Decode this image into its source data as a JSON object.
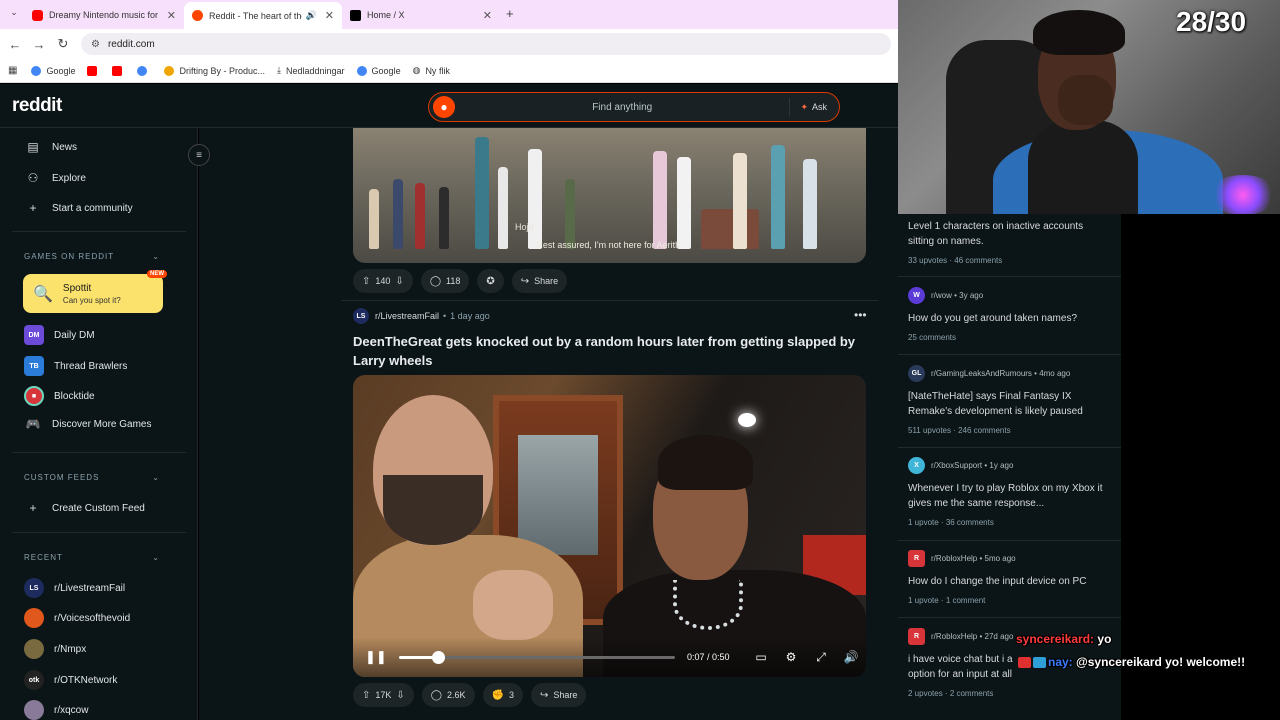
{
  "browser": {
    "tabs": [
      {
        "title": "Dreamy Nintendo music for sle",
        "color": "#ff0000"
      },
      {
        "title": "Reddit - The heart of the in",
        "color": "#ff4500"
      },
      {
        "title": "Home / X",
        "color": "#000000"
      }
    ],
    "url": "reddit.com",
    "bookmarks": [
      {
        "label": "Google",
        "color": "#4285f4"
      },
      {
        "label": "",
        "color": "#ff0000"
      },
      {
        "label": "",
        "color": "#ff0000"
      },
      {
        "label": "",
        "color": "#4285f4"
      },
      {
        "label": "Drifting By - Produc...",
        "color": "#f0a500"
      },
      {
        "label": "Nedladdningar",
        "color": "#333333"
      },
      {
        "label": "Google",
        "color": "#4285f4"
      },
      {
        "label": "Ny flik",
        "color": "#555555"
      }
    ]
  },
  "reddit": {
    "logo": "reddit",
    "search_placeholder": "Find anything",
    "ask_label": "Ask"
  },
  "sidebar": {
    "nav": [
      {
        "label": "News",
        "icon": "news-icon"
      },
      {
        "label": "Explore",
        "icon": "explore-icon"
      },
      {
        "label": "Start a community",
        "icon": "plus-icon"
      }
    ],
    "games_heading": "GAMES ON REDDIT",
    "spottit": {
      "title": "Spottit",
      "subtitle": "Can you spot it?",
      "badge": "NEW"
    },
    "games": [
      {
        "label": "Daily DM",
        "color": "#6b4bd8"
      },
      {
        "label": "Thread Brawlers",
        "color": "#2b7bd8"
      },
      {
        "label": "Blocktide",
        "color": "#d8353b"
      },
      {
        "label": "Discover More Games",
        "color": "#0b1416"
      }
    ],
    "custom_heading": "CUSTOM FEEDS",
    "create_feed": "Create Custom Feed",
    "recent_heading": "RECENT",
    "recent": [
      {
        "label": "r/LivestreamFail",
        "color": "#1d2b5e"
      },
      {
        "label": "r/Voicesofthevoid",
        "color": "#e0581c"
      },
      {
        "label": "r/Nmpx",
        "color": "#7a6a40"
      },
      {
        "label": "r/OTKNetwork",
        "color": "#222222"
      },
      {
        "label": "r/xqcow",
        "color": "#8a7a9a"
      }
    ]
  },
  "feed": {
    "post1": {
      "caption_name": "Hojo",
      "caption_text": "Rest assured, I'm not here for Aerith.",
      "upvotes": "140",
      "comments": "118",
      "share": "Share"
    },
    "post2": {
      "subreddit": "r/LivestreamFail",
      "avatar": "LS",
      "time": "1 day ago",
      "title": "DeenTheGreat gets knocked out by a random hours later from getting slapped by Larry wheels",
      "video_time": "0:07 / 0:50",
      "progress": 0.14,
      "upvotes": "17K",
      "comments": "2.6K",
      "awards": "3",
      "share": "Share"
    }
  },
  "rail": {
    "posts": [
      {
        "subreddit": "",
        "time": "",
        "title": "Level 1 characters on inactive accounts sitting on names.",
        "upvotes": "33 upvotes",
        "comments": "46 comments",
        "color": ""
      },
      {
        "subreddit": "r/wow",
        "time": "3y ago",
        "title": "How do you get around taken names?",
        "upvotes": "",
        "comments": "25 comments",
        "color": "#5a3bd6"
      },
      {
        "subreddit": "r/GamingLeaksAndRumours",
        "time": "4mo ago",
        "title": "[NateTheHate] says Final Fantasy IX Remake's development is likely paused",
        "upvotes": "511 upvotes",
        "comments": "246 comments",
        "color": "#2a3a5a"
      },
      {
        "subreddit": "r/XboxSupport",
        "time": "1y ago",
        "title": "Whenever I try to play Roblox on my Xbox it gives me the same response...",
        "upvotes": "1 upvote",
        "comments": "36 comments",
        "color": "#3fb6d8"
      },
      {
        "subreddit": "r/RobloxHelp",
        "time": "5mo ago",
        "title": "How do I change the input device on PC",
        "upvotes": "1 upvote",
        "comments": "1 comment",
        "color": "#d8353b"
      },
      {
        "subreddit": "r/RobloxHelp",
        "time": "27d ago",
        "title": "i have voice chat but i a",
        "title2": "option for an input at all",
        "upvotes": "2 upvotes",
        "comments": "2 comments",
        "color": "#d8353b"
      }
    ]
  },
  "stream": {
    "counter": "28/30",
    "chat": [
      {
        "user": "syncereikard:",
        "message": "yo",
        "user_color": "#ff3b3b"
      },
      {
        "user": "nay:",
        "message": "@syncereikard yo! welcome!!",
        "user_color": "#3b7bff"
      }
    ]
  }
}
